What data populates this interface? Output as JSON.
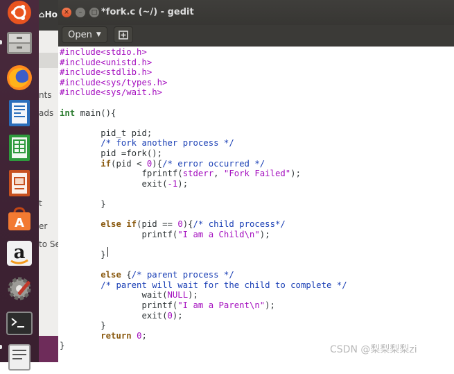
{
  "window": {
    "title": "*fork.c (~/) - gedit",
    "open_label": "Open",
    "close_glyph": "×",
    "minimize_glyph": "–",
    "maximize_glyph": "□"
  },
  "background_window": {
    "home_label": "Ho",
    "sidebar_fragments": [
      "nts",
      "ads",
      "t",
      "er",
      "to Se"
    ]
  },
  "launcher": {
    "items": [
      "ubuntu-logo-icon",
      "files-icon",
      "firefox-icon",
      "writer-icon",
      "calc-icon",
      "impress-icon",
      "software-center-icon",
      "amazon-icon",
      "system-settings-icon",
      "terminal-icon",
      "text-editor-icon"
    ]
  },
  "code_lines": [
    "#include<stdio.h>",
    "#include<unistd.h>",
    "#include<stdlib.h>",
    "#include<sys/types.h>",
    "#include<sys/wait.h>",
    "",
    "int main(){",
    "",
    "        pid_t pid;",
    "        /* fork another process */",
    "        pid =fork();",
    "        if(pid < 0){/* error occurred */",
    "                fprintf(stderr, \"Fork Failed\");",
    "                exit(-1);",
    "",
    "        }",
    "",
    "        else if(pid == 0){/* child process*/",
    "                printf(\"I am a Child\\n\");",
    "",
    "        }",
    "",
    "        else {/* parent process */",
    "        /* parent will wait for the child to complete */",
    "                wait(NULL);",
    "                printf(\"I am a Parent\\n\");",
    "                exit(0);",
    "        }",
    "        return 0;",
    "}"
  ],
  "watermark": "CSDN @梨梨梨梨zi",
  "colors": {
    "preprocessor": "#a40fbf",
    "comment": "#1a3fb5",
    "type": "#2e7d32",
    "string": "#a40fbf"
  }
}
